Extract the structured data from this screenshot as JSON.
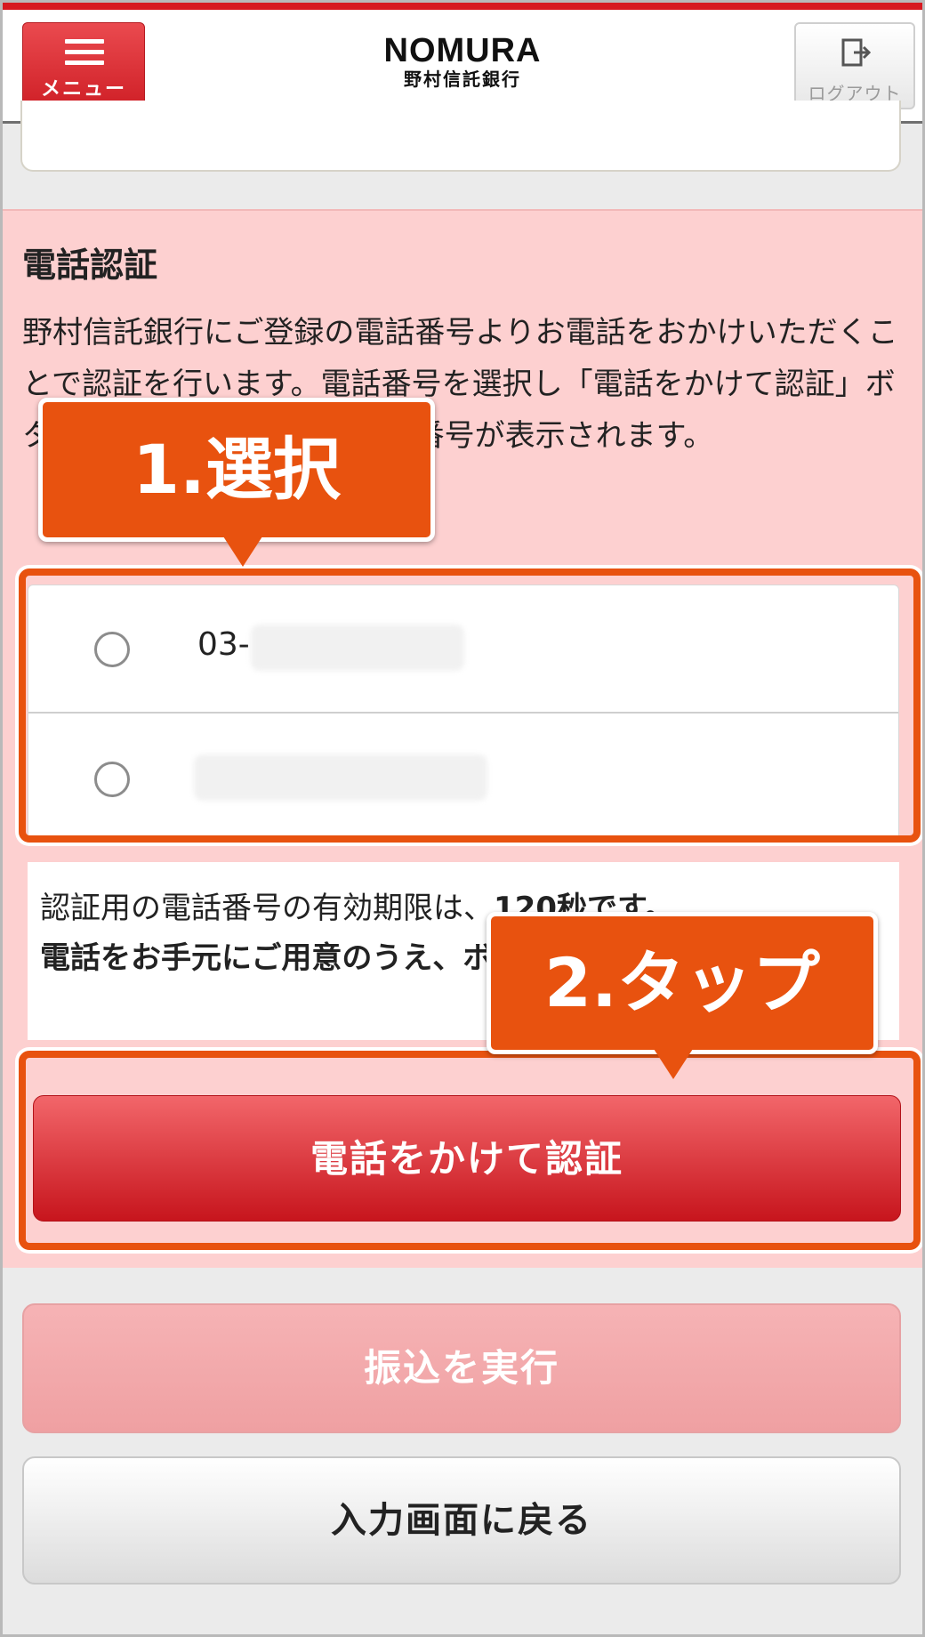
{
  "header": {
    "menu_label": "メニュー",
    "logo_main": "NOMURA",
    "logo_sub": "野村信託銀行",
    "logout_label": "ログアウト"
  },
  "auth": {
    "title": "電話認証",
    "description": "野村信託銀行にご登録の電話番号よりお電話をおかけいただくことで認証を行います。電話番号を選択し「電話をかけて認証」ボタンを押すと、認証用の電話番号が表示されます。",
    "phones": [
      {
        "number_prefix": "03-",
        "selected": false
      },
      {
        "number_prefix": "",
        "selected": false
      }
    ],
    "notice_part1": "認証用の電話番号の有効期限は、",
    "notice_bold1": "120秒です。",
    "notice_bold2": "電話をお手元にご用意のうえ、ボタンを押してください。",
    "call_button": "電話をかけて認証"
  },
  "actions": {
    "execute_button": "振込を実行",
    "back_button": "入力画面に戻る"
  },
  "annotations": {
    "step1": "1.選択",
    "step2": "2.タップ",
    "color": "#e8520f"
  }
}
